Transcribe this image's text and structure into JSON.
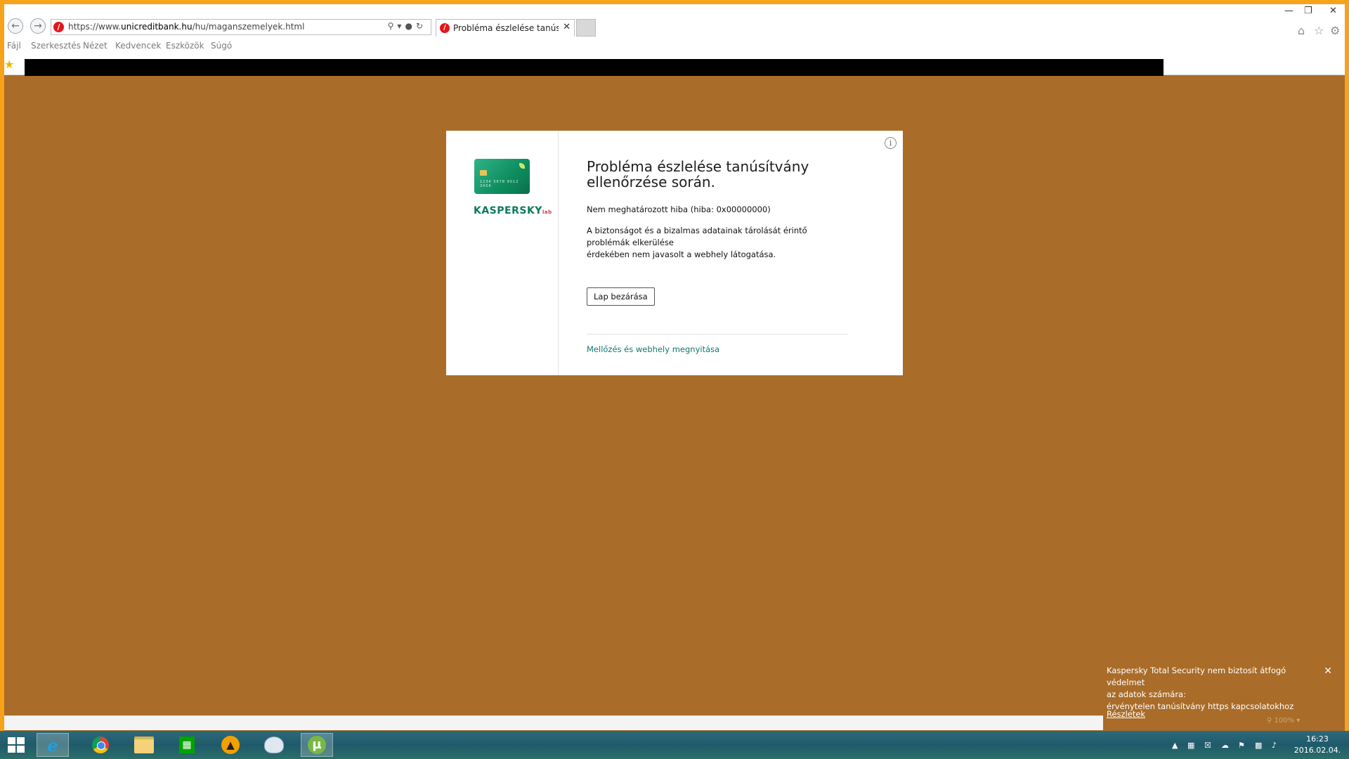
{
  "browser": {
    "url_prefix": "https://www.",
    "url_domain": "unicreditbank.hu",
    "url_path": "/hu/maganszemelyek.html",
    "tab_title": "Probléma észlelése tanúsítv...",
    "menu": [
      "Fájl",
      "Szerkesztés",
      "Nézet",
      "Kedvencek",
      "Eszközök",
      "Súgó"
    ]
  },
  "dialog": {
    "brand": "KASPERSKY",
    "brand_suffix": "lab",
    "card_number": "1234 5678 9012 3456",
    "title": "Probléma észlelése tanúsítvány ellenőrzése során.",
    "error_line": "Nem meghatározott hiba (hiba: 0x00000000)",
    "description_1": "A biztonságot és a bizalmas adatainak tárolását érintő problémák elkerülése",
    "description_2": "érdekében nem javasolt a webhely látogatása.",
    "close_button": "Lap bezárása",
    "ignore_link": "Mellőzés és webhely megnyitása"
  },
  "notification": {
    "line_1": "Kaspersky Total Security nem biztosít átfogó védelmet",
    "line_2": "az adatok számára:",
    "line_3": "érvénytelen tanúsítvány https kapcsolatokhoz",
    "details_link": "Részletek",
    "zoom": "100%"
  },
  "taskbar": {
    "time": "16:23",
    "date": "2016.02.04."
  },
  "colors": {
    "page_bg": "#a96c29",
    "window_border": "#f7a21b",
    "link": "#117a6d",
    "brand_green": "#0a7a5a"
  }
}
